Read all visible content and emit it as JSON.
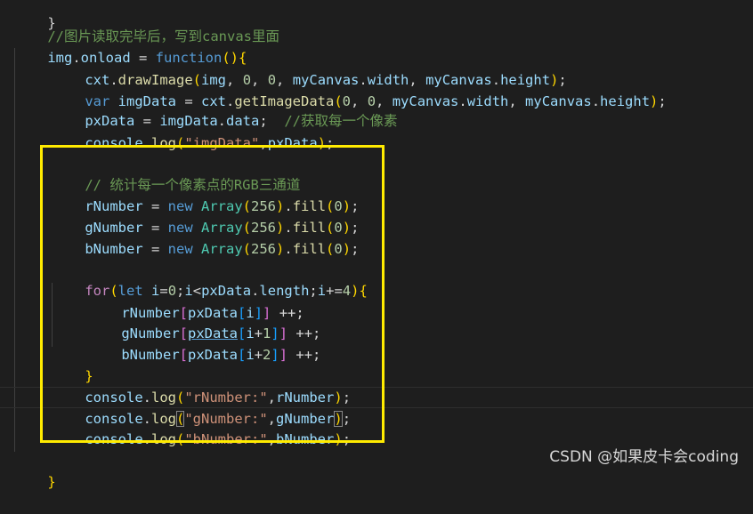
{
  "code": {
    "line_top_fragment": "}",
    "line_comment_onload": "//图片读取完毕后，写到canvas里面",
    "line_onload": {
      "obj": "img",
      "prop": "onload",
      "eq": " = ",
      "kw": "function",
      "rest": "(){"
    },
    "line_draw": {
      "obj": "cxt",
      "method": "drawImage",
      "args_a": "img",
      "comma1": ", ",
      "n0": "0",
      "comma2": ", ",
      "n1": "0",
      "comma3": ", ",
      "w_obj": "myCanvas",
      "w_prop": "width",
      "comma4": ", ",
      "h_obj": "myCanvas",
      "h_prop": "height",
      "end": ");"
    },
    "line_getdata": {
      "kw": "var",
      "name": "imgData",
      "eq": " = ",
      "obj": "cxt",
      "method": "getImageData",
      "n0": "0",
      "n1": "0",
      "w_obj": "myCanvas",
      "w_prop": "width",
      "h_obj": "myCanvas",
      "h_prop": "height",
      "end": ");"
    },
    "line_pxdata": {
      "name": "pxData",
      "eq": " = ",
      "obj": "imgData",
      "prop": "data",
      "semi": ";  ",
      "comment": "//获取每一个像素"
    },
    "line_log_imgdata": {
      "obj": "console",
      "method": "log",
      "str": "\"imgData\"",
      "comma": ",",
      "arg": "pxData",
      "end": ");"
    },
    "line_comment_rgb": "// 统计每一个像素点的RGB三通道",
    "arrays": [
      {
        "name": "rNumber",
        "eq": " = ",
        "kw": "new",
        "cls": "Array",
        "size": "256",
        "fill": "fill",
        "zero": "0"
      },
      {
        "name": "gNumber",
        "eq": " = ",
        "kw": "new",
        "cls": "Array",
        "size": "256",
        "fill": "fill",
        "zero": "0"
      },
      {
        "name": "bNumber",
        "eq": " = ",
        "kw": "new",
        "cls": "Array",
        "size": "256",
        "fill": "fill",
        "zero": "0"
      }
    ],
    "line_for": {
      "kw": "for",
      "let": "let",
      "i": "i",
      "init": "=",
      "zero": "0",
      "semi1": ";",
      "i2": "i",
      "lt": "<",
      "arr": "pxData",
      "len": "length",
      "semi2": ";",
      "i3": "i",
      "inc": "+=",
      "four": "4",
      "open": "{"
    },
    "loop_body": [
      {
        "target": "rNumber",
        "arr": "pxData",
        "idx": "i",
        "offset_op": "",
        "offset": "",
        "inc": " ++;"
      },
      {
        "target": "gNumber",
        "arr": "pxData",
        "idx": "i",
        "offset_op": "+",
        "offset": "1",
        "inc": " ++;"
      },
      {
        "target": "bNumber",
        "arr": "pxData",
        "idx": "i",
        "offset_op": "+",
        "offset": "2",
        "inc": " ++;"
      }
    ],
    "line_for_close": "}",
    "logs": [
      {
        "obj": "console",
        "method": "log",
        "str": "\"rNumber:\"",
        "comma": ",",
        "arg": "rNumber",
        "end": ";"
      },
      {
        "obj": "console",
        "method": "log",
        "str": "\"gNumber:\"",
        "comma": ",",
        "arg": "gNumber",
        "end": ";"
      },
      {
        "obj": "console",
        "method": "log",
        "str": "\"bNumber:\"",
        "comma": ",",
        "arg": "bNumber",
        "end": ";"
      }
    ],
    "line_close": "}"
  },
  "watermark": "CSDN @如果皮卡会coding",
  "colors": {
    "background": "#1e1e1e",
    "highlight_box": "#ffeb00"
  }
}
